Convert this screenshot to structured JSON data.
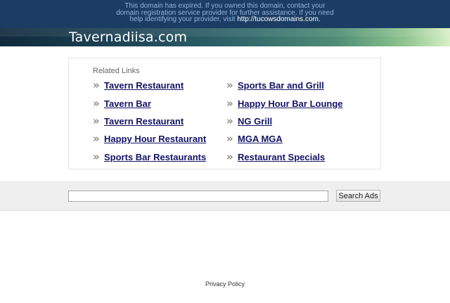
{
  "banner": {
    "line1": "This domain has expired. If you owned this domain, contact your",
    "line2": "domain registration service provider for further assistance. If you need",
    "line3_prefix": "help identifying your provider, visit ",
    "line3_url": "http://tucowsdomains.com."
  },
  "header": {
    "site_title": "Tavernadiisa.com"
  },
  "related": {
    "title": "Related Links",
    "left": [
      {
        "label": "Tavern Restaurant"
      },
      {
        "label": "Tavern Bar"
      },
      {
        "label": "Tavern Restaurant"
      },
      {
        "label": "Happy Hour Restaurant"
      },
      {
        "label": "Sports Bar Restaurants"
      }
    ],
    "right": [
      {
        "label": "Sports Bar and Grill"
      },
      {
        "label": "Happy Hour Bar Lounge"
      },
      {
        "label": "NG Grill"
      },
      {
        "label": "MGA MGA"
      },
      {
        "label": "Restaurant Specials"
      }
    ],
    "bullet_glyph": "»"
  },
  "search": {
    "input_value": "",
    "button_label": "Search Ads"
  },
  "footer": {
    "privacy_label": "Privacy Policy"
  },
  "colors": {
    "banner_bg": "#1c3d63",
    "banner_text": "#8fb4dd",
    "link": "#131466",
    "search_band": "#efefef"
  }
}
